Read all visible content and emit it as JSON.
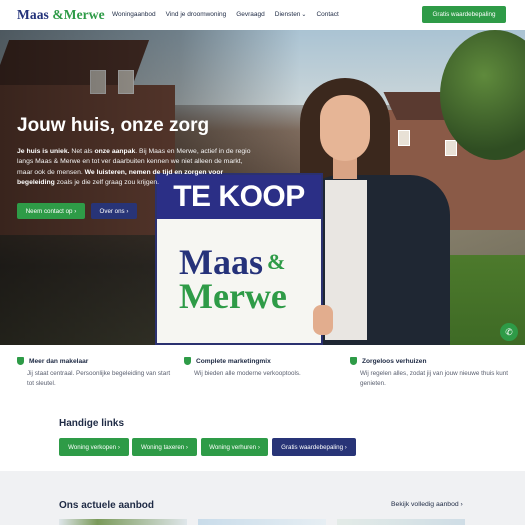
{
  "nav": {
    "logo_part1": "Maas",
    "logo_amp": "&",
    "logo_part2": "Merwe",
    "items": [
      "Woningaanbod",
      "Vind je droomwoning",
      "Gevraagd",
      "Diensten",
      "Contact"
    ],
    "cta": "Gratis waardebepaling"
  },
  "hero": {
    "title": "Jouw huis, onze zorg",
    "text_bold1": "Je huis is uniek.",
    "text_1": " Net als ",
    "text_bold2": "onze aanpak",
    "text_2": ". Bij Maas en Merwe, actief in de regio langs Maas & Merwe en tot ver daarbuiten kennen we niet alleen de markt, maar ook de mensen. ",
    "text_bold3": "We luisteren, nemen de tijd en zorgen voor begeleiding",
    "text_3": " zoals je die zelf graag zou krijgen.",
    "btn_contact": "Neem contact op ›",
    "btn_about": "Over ons ›",
    "sign_title": "TE KOOP",
    "sign_brand1": "Maas",
    "sign_brand_amp": "&",
    "sign_brand2": "Merwe"
  },
  "features": [
    {
      "title": "Meer dan makelaar",
      "desc": "Jij staat centraal. Persoonlijke begeleiding van start tot sleutel."
    },
    {
      "title": "Complete marketingmix",
      "desc": "Wij bieden alle moderne verkooptools."
    },
    {
      "title": "Zorgeloos verhuizen",
      "desc": "Wij regelen alles, zodat jij van jouw nieuwe thuis kunt genieten."
    }
  ],
  "links": {
    "title": "Handige links",
    "items": [
      "Woning verkopen ›",
      "Woning taxeren ›",
      "Woning verhuren ›",
      "Gratis waardebepaling ›"
    ]
  },
  "aanbod": {
    "title": "Ons actuele aanbod",
    "link": "Bekijk volledig aanbod ›"
  },
  "colors": {
    "brand_green": "#2e9b47",
    "brand_blue": "#283477"
  },
  "icons": {
    "whatsapp": "whatsapp-icon",
    "feature": "shield-check-icon"
  }
}
